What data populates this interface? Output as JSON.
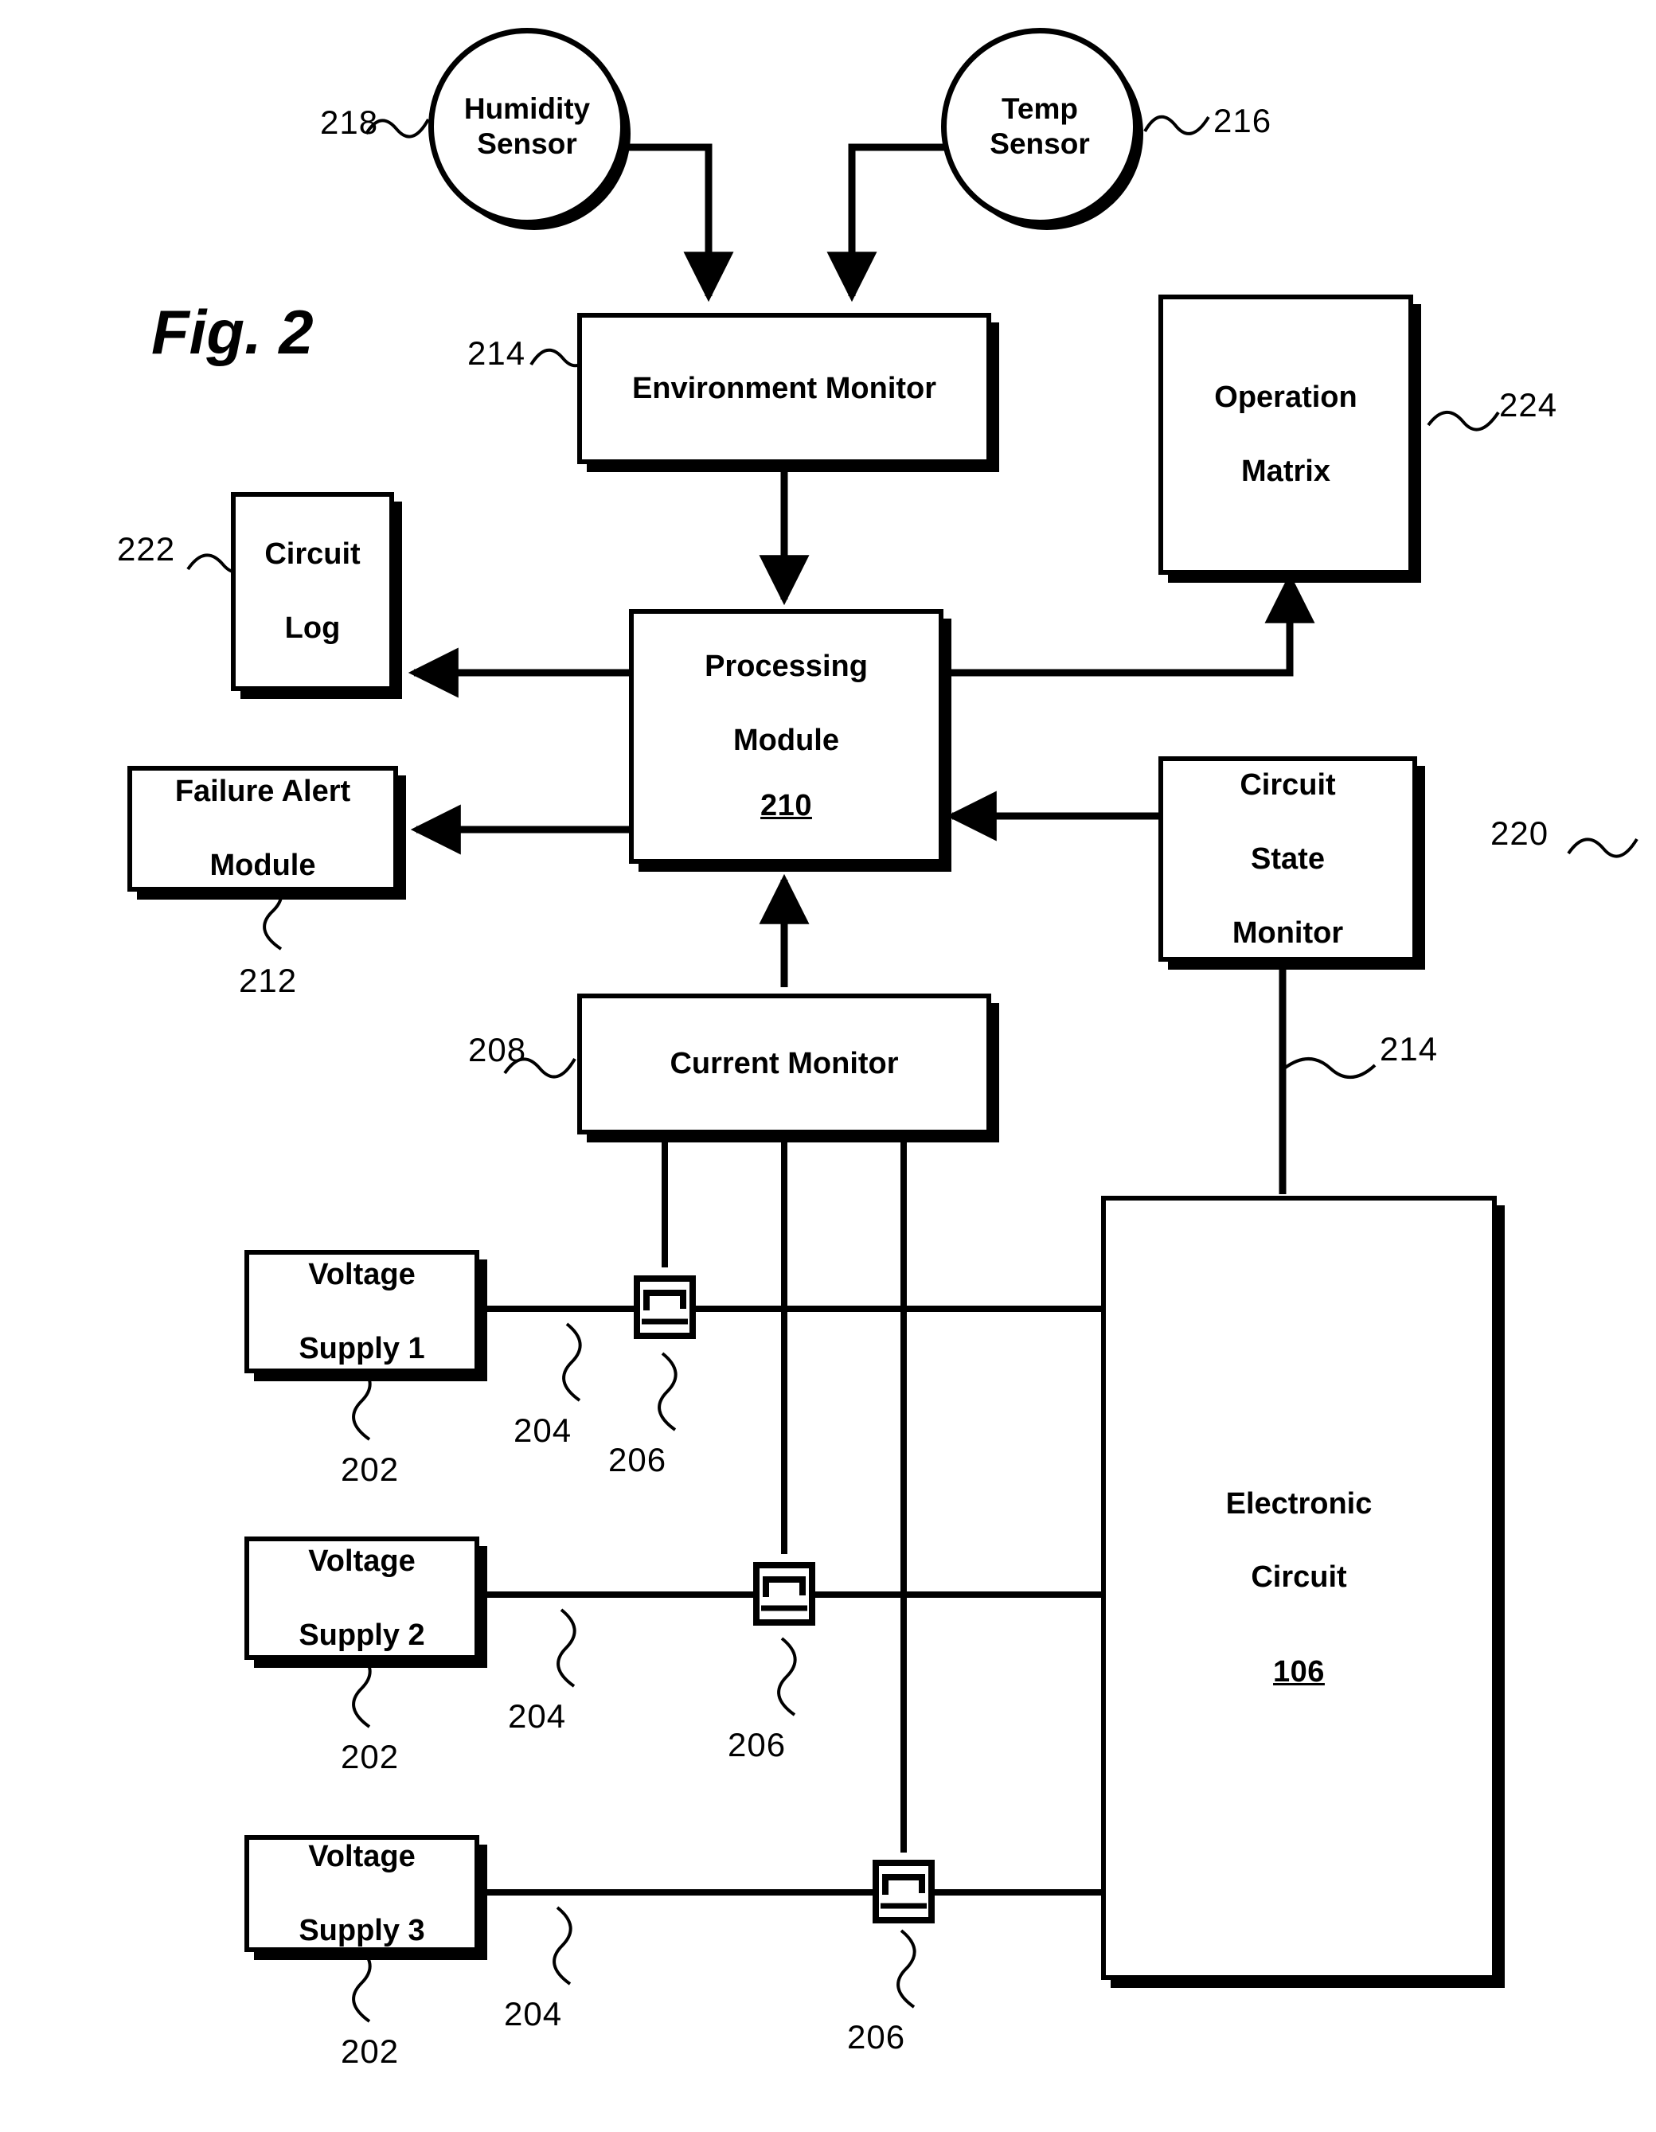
{
  "figure": {
    "title": "Fig. 2"
  },
  "sensors": [
    {
      "id": "humidity-sensor",
      "line1": "Humidity",
      "line2": "Sensor",
      "ref": "218"
    },
    {
      "id": "temp-sensor",
      "line1": "Temp",
      "line2": "Sensor",
      "ref": "216"
    }
  ],
  "blocks": {
    "environment_monitor": {
      "label": "Environment Monitor",
      "ref": "214"
    },
    "operation_matrix": {
      "line1": "Operation",
      "line2": "Matrix",
      "ref": "224"
    },
    "circuit_log": {
      "line1": "Circuit",
      "line2": "Log",
      "ref": "222"
    },
    "processing_module": {
      "line1": "Processing",
      "line2": "Module",
      "refnum": "210"
    },
    "failure_alert_module": {
      "line1": "Failure Alert",
      "line2": "Module",
      "ref": "212"
    },
    "circuit_state_monitor": {
      "line1": "Circuit",
      "line2": "State",
      "line3": "Monitor",
      "ref": "220",
      "link_ref": "214"
    },
    "current_monitor": {
      "label": "Current Monitor",
      "ref": "208"
    },
    "electronic_circuit": {
      "line1": "Electronic",
      "line2": "Circuit",
      "refnum": "106"
    }
  },
  "voltage_supplies": [
    {
      "line1": "Voltage",
      "line2": "Supply 1",
      "ref": "202",
      "line_ref": "204",
      "sensor_ref": "206"
    },
    {
      "line1": "Voltage",
      "line2": "Supply 2",
      "ref": "202",
      "line_ref": "204",
      "sensor_ref": "206"
    },
    {
      "line1": "Voltage",
      "line2": "Supply 3",
      "ref": "202",
      "line_ref": "204",
      "sensor_ref": "206"
    }
  ],
  "icons": {
    "current_sensor": "current-sensor-icon"
  },
  "colors": {
    "ink": "#000000",
    "paper": "#ffffff"
  }
}
